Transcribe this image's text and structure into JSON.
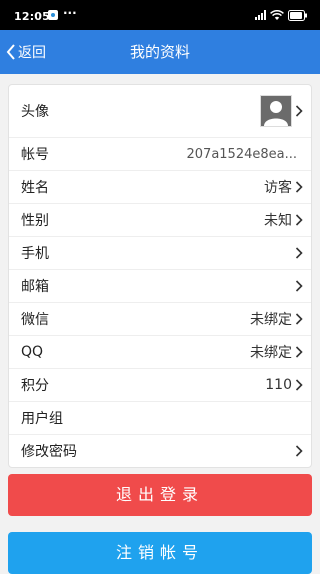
{
  "status_bar": {
    "time": "12:05",
    "more": "···"
  },
  "nav": {
    "back_label": "返回",
    "title": "我的资料"
  },
  "profile": {
    "avatar_label": "头像",
    "account_label": "帐号",
    "account_value": "207a1524e8ea...",
    "name_label": "姓名",
    "name_value": "访客",
    "gender_label": "性别",
    "gender_value": "未知",
    "phone_label": "手机",
    "email_label": "邮箱",
    "wechat_label": "微信",
    "wechat_value": "未绑定",
    "qq_label": "QQ",
    "qq_value": "未绑定",
    "points_label": "积分",
    "points_value": "110",
    "usergroup_label": "用户组",
    "password_label": "修改密码"
  },
  "actions": {
    "logout_label": "退出登录",
    "deactivate_label": "注销帐号"
  },
  "colors": {
    "nav_bg": "#2f7fe0",
    "logout_bg": "#f04b4b",
    "deactivate_bg": "#1fa2ee"
  }
}
